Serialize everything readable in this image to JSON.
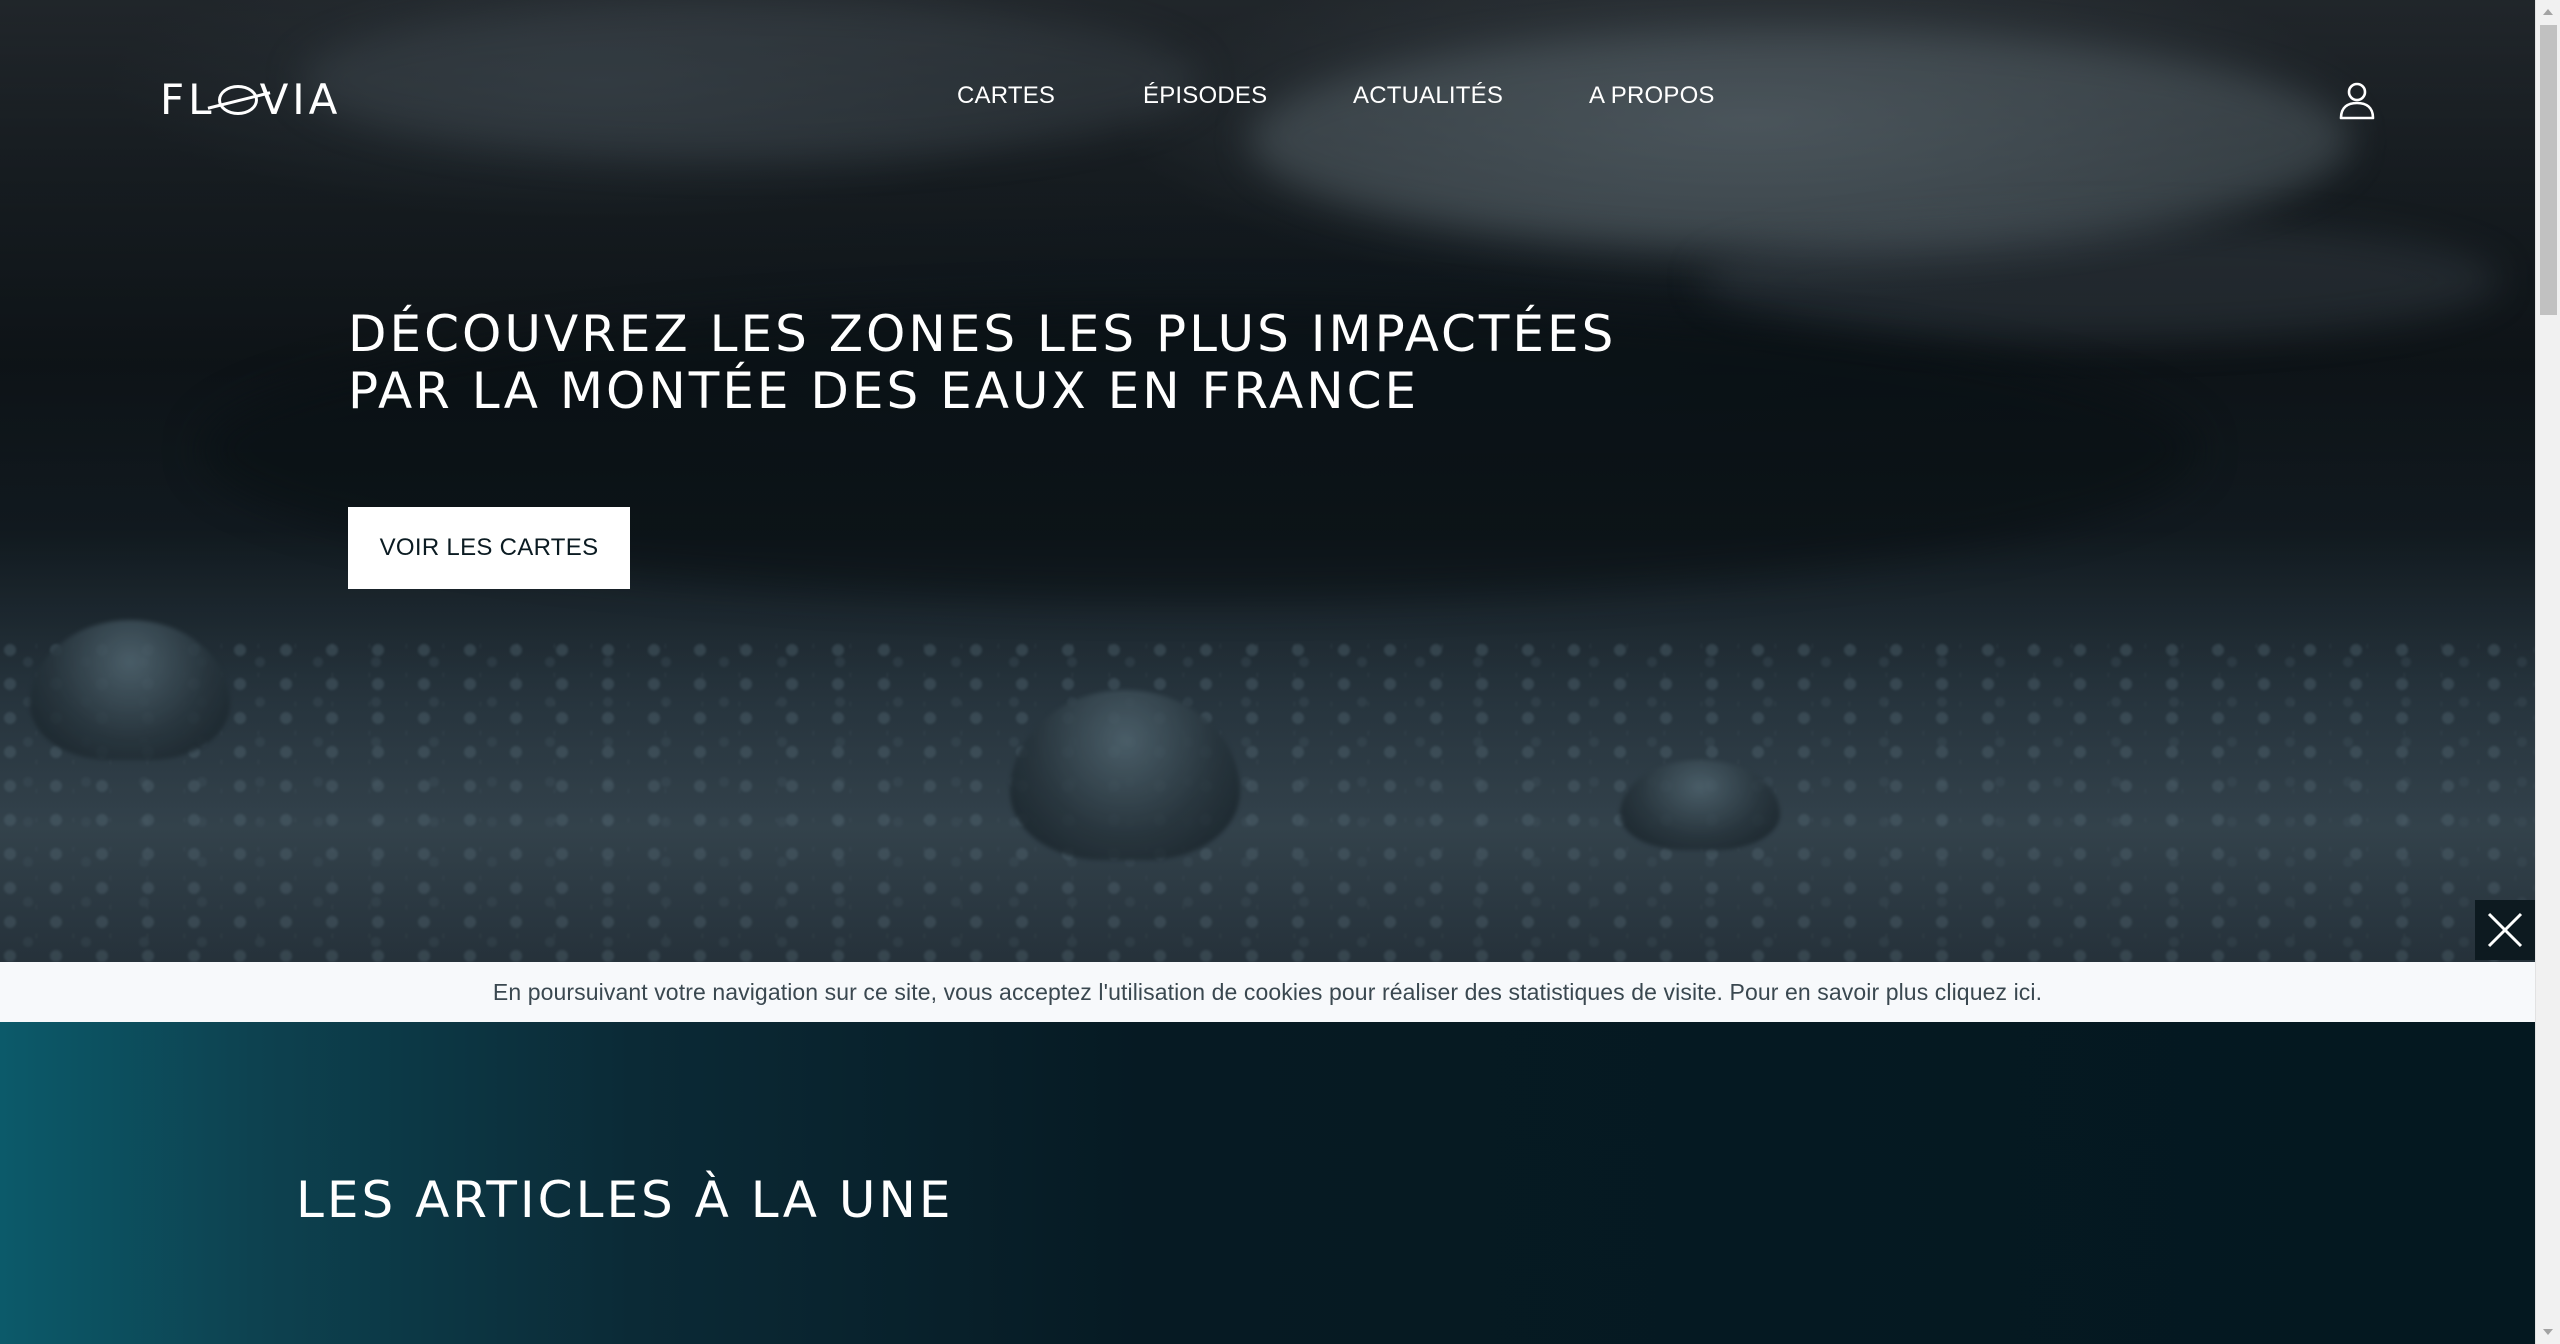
{
  "header": {
    "logo_text": "FLOVIA",
    "nav": [
      "CARTES",
      "ÉPISODES",
      "ACTUALITÉS",
      "A PROPOS"
    ],
    "user_icon": "user-icon"
  },
  "hero": {
    "title": "DÉCOUVREZ LES ZONES LES PLUS IMPACTÉES PAR LA MONTÉE DES EAUX EN FRANCE",
    "cta_label": "VOIR LES CARTES"
  },
  "cookie": {
    "text": "En poursuivant votre navigation sur ce site, vous acceptez l'utilisation de cookies pour réaliser des statistiques de visite. Pour en savoir plus cliquez ici.",
    "close_icon": "close-icon"
  },
  "articles": {
    "heading": "LES ARTICLES À LA UNE"
  },
  "colors": {
    "accent_teal": "#0c5a6a",
    "dark_bg": "#041820",
    "banner_bg": "#f7f9fb"
  }
}
